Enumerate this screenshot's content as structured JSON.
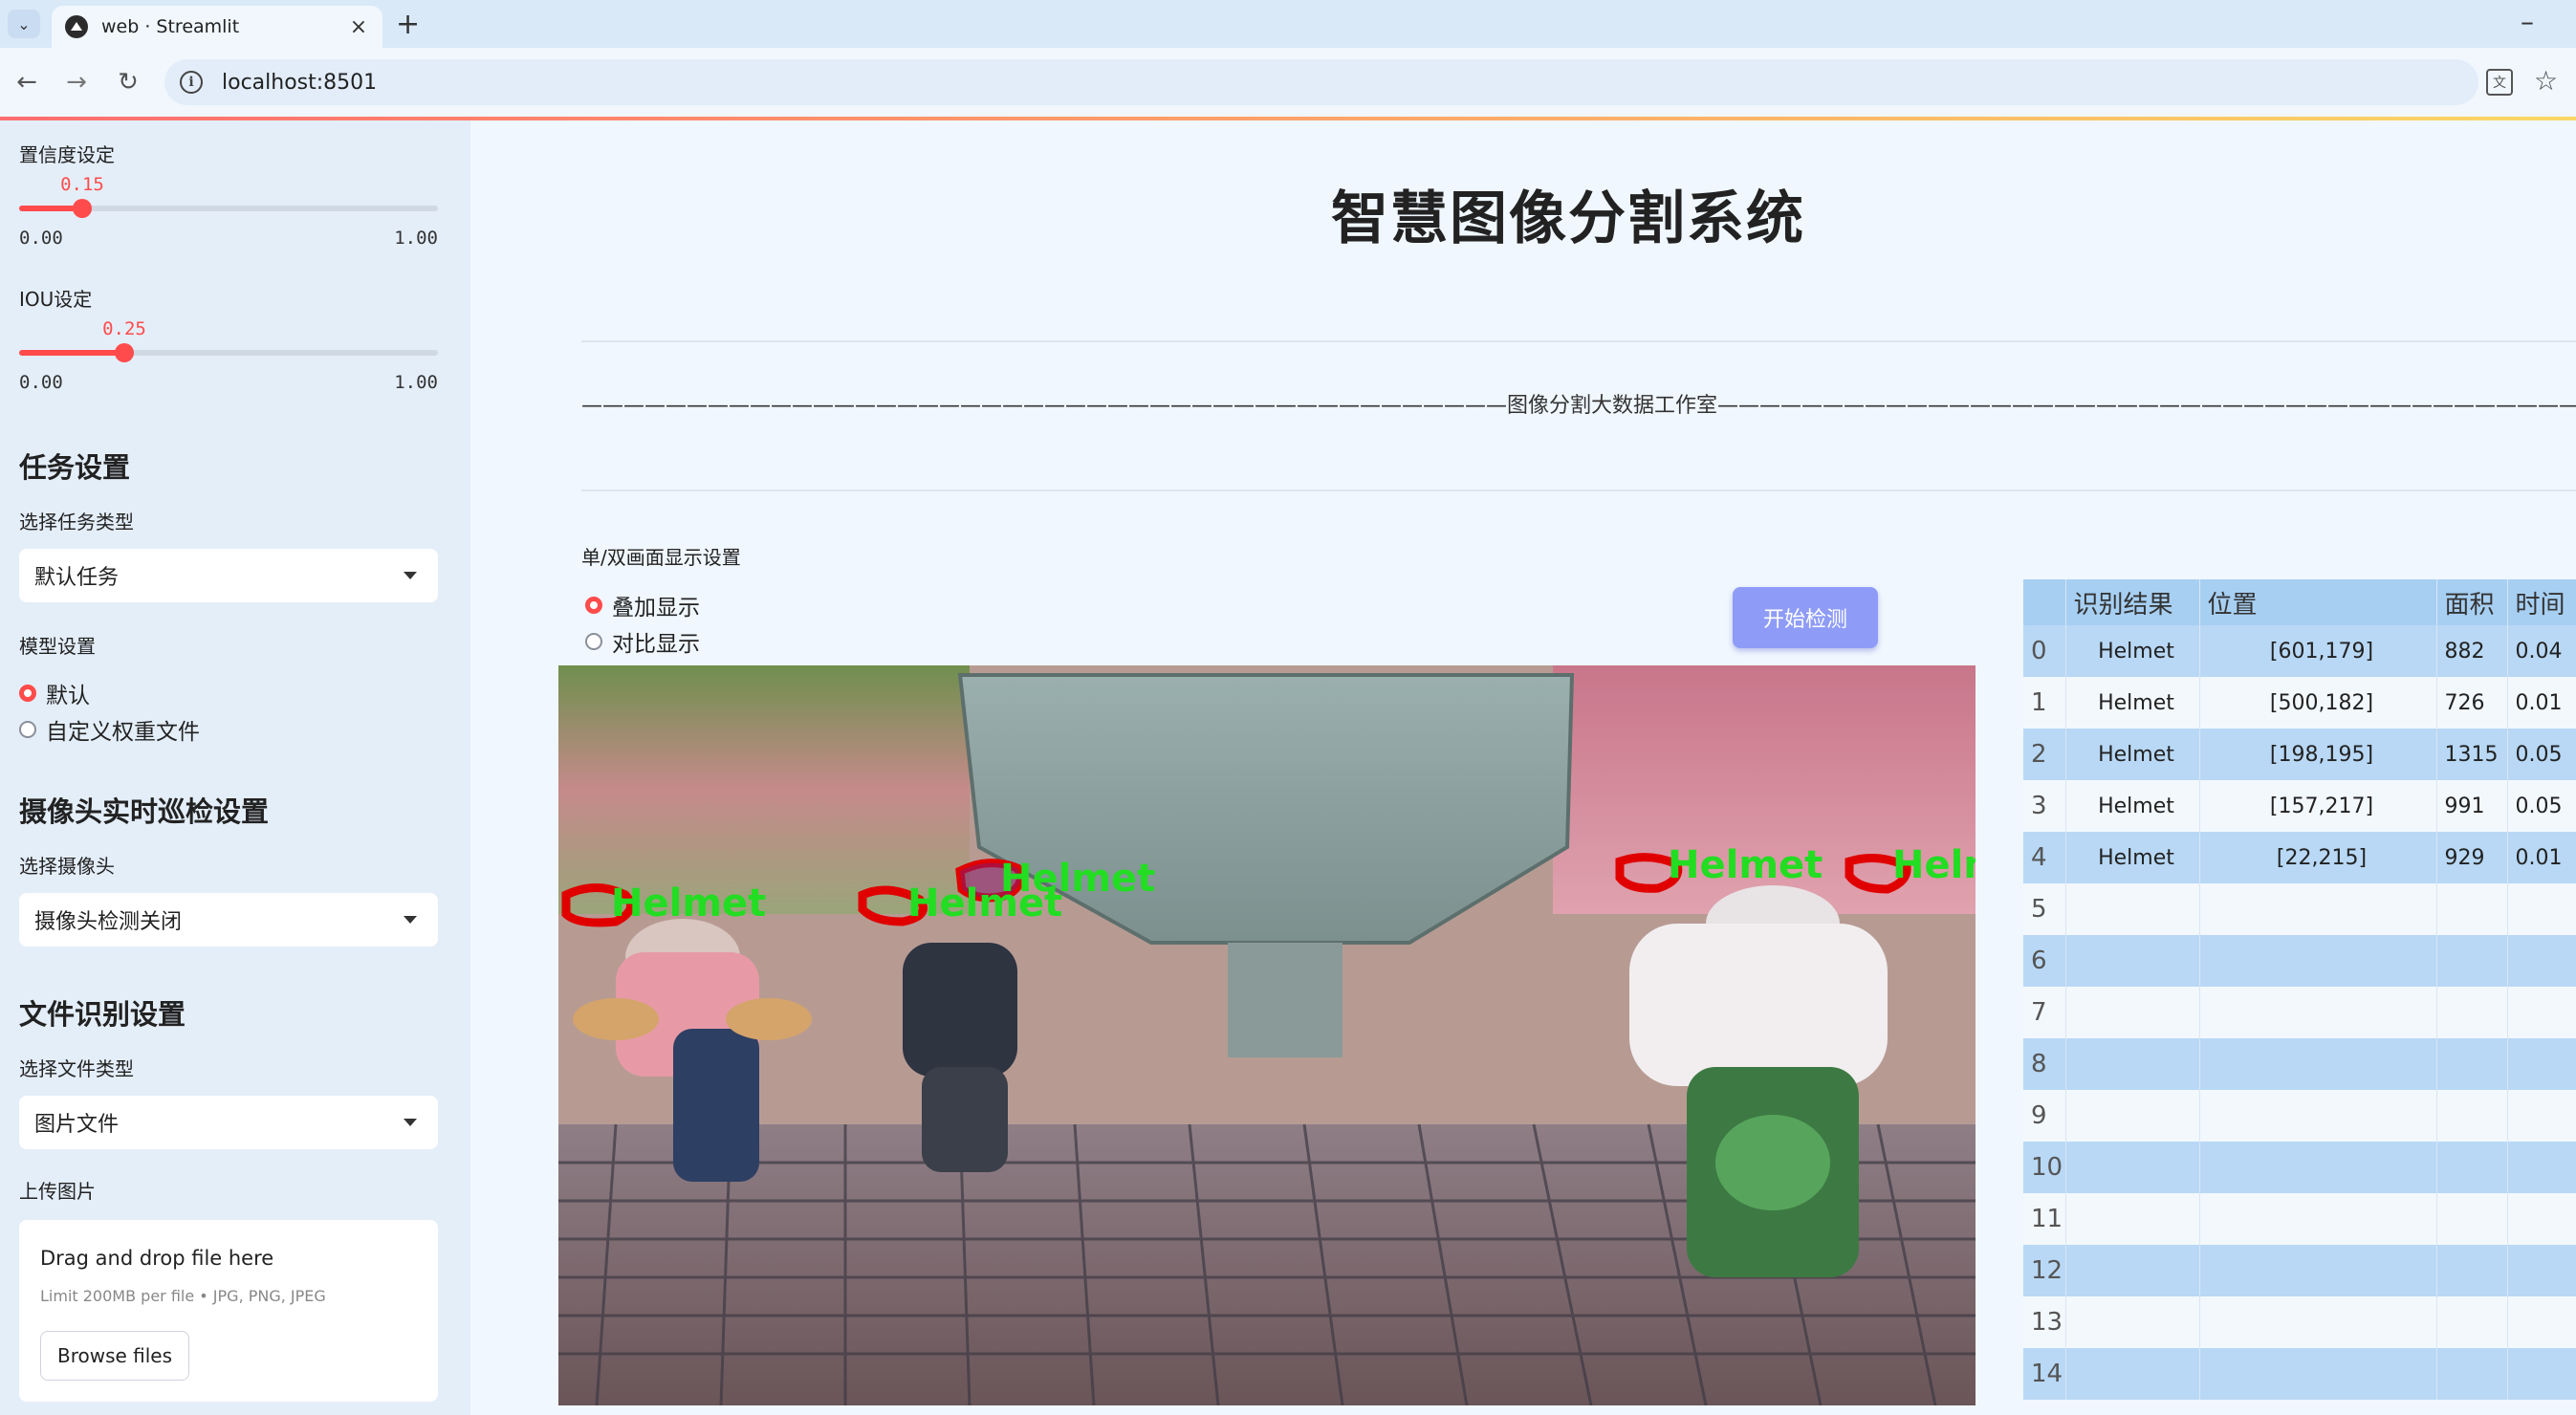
{
  "browser": {
    "tab_title": "web · Streamlit",
    "url": "localhost:8501"
  },
  "sidebar": {
    "confidence": {
      "label": "置信度设定",
      "value": "0.15",
      "value_num": 0.15,
      "min": "0.00",
      "max": "1.00"
    },
    "iou": {
      "label": "IOU设定",
      "value": "0.25",
      "value_num": 0.25,
      "min": "0.00",
      "max": "1.00"
    },
    "task_heading": "任务设置",
    "task_type_label": "选择任务类型",
    "task_type_value": "默认任务",
    "model_label": "模型设置",
    "model_options": [
      "默认",
      "自定义权重文件"
    ],
    "model_selected": "默认",
    "camera_heading": "摄像头实时巡检设置",
    "camera_label": "选择摄像头",
    "camera_value": "摄像头检测关闭",
    "file_heading": "文件识别设置",
    "file_type_label": "选择文件类型",
    "file_type_value": "图片文件",
    "upload_label": "上传图片",
    "upload_drop_text": "Drag and drop file here",
    "upload_limit_text": "Limit 200MB per file • JPG, PNG, JPEG",
    "browse_label": "Browse files"
  },
  "main": {
    "title": "智慧图像分割系统",
    "studio_line": "————————————————————————————————————————————图像分割大数据工作室————————————————————————————————————————————",
    "display_mode_label": "单/双画面显示设置",
    "display_options": [
      "叠加显示",
      "对比显示"
    ],
    "display_selected": "叠加显示",
    "detect_button": "开始检测",
    "detections_image": {
      "labels": [
        "Helmet",
        "Helmet",
        "Helmet",
        "Helmet",
        "Helmet"
      ],
      "label_color": "#22dd22",
      "mask_color": "#e00000"
    }
  },
  "table": {
    "columns": [
      "",
      "识别结果",
      "位置",
      "面积",
      "时间"
    ],
    "rows": [
      {
        "idx": "0",
        "cls": "Helmet",
        "pos": "[601,179]",
        "area": "882",
        "time": "0.04"
      },
      {
        "idx": "1",
        "cls": "Helmet",
        "pos": "[500,182]",
        "area": "726",
        "time": "0.01"
      },
      {
        "idx": "2",
        "cls": "Helmet",
        "pos": "[198,195]",
        "area": "1315",
        "time": "0.05"
      },
      {
        "idx": "3",
        "cls": "Helmet",
        "pos": "[157,217]",
        "area": "991",
        "time": "0.05"
      },
      {
        "idx": "4",
        "cls": "Helmet",
        "pos": "[22,215]",
        "area": "929",
        "time": "0.01"
      },
      {
        "idx": "5",
        "cls": "",
        "pos": "",
        "area": "",
        "time": ""
      },
      {
        "idx": "6",
        "cls": "",
        "pos": "",
        "area": "",
        "time": ""
      },
      {
        "idx": "7",
        "cls": "",
        "pos": "",
        "area": "",
        "time": ""
      },
      {
        "idx": "8",
        "cls": "",
        "pos": "",
        "area": "",
        "time": ""
      },
      {
        "idx": "9",
        "cls": "",
        "pos": "",
        "area": "",
        "time": ""
      },
      {
        "idx": "10",
        "cls": "",
        "pos": "",
        "area": "",
        "time": ""
      },
      {
        "idx": "11",
        "cls": "",
        "pos": "",
        "area": "",
        "time": ""
      },
      {
        "idx": "12",
        "cls": "",
        "pos": "",
        "area": "",
        "time": ""
      },
      {
        "idx": "13",
        "cls": "",
        "pos": "",
        "area": "",
        "time": ""
      },
      {
        "idx": "14",
        "cls": "",
        "pos": "",
        "area": "",
        "time": ""
      }
    ]
  },
  "colors": {
    "accent": "#ff4b4b",
    "sidebar_bg": "#e4eef9",
    "page_bg": "#f0f7fe",
    "button": "#8f9cf7",
    "table_header": "#a7cff2"
  }
}
